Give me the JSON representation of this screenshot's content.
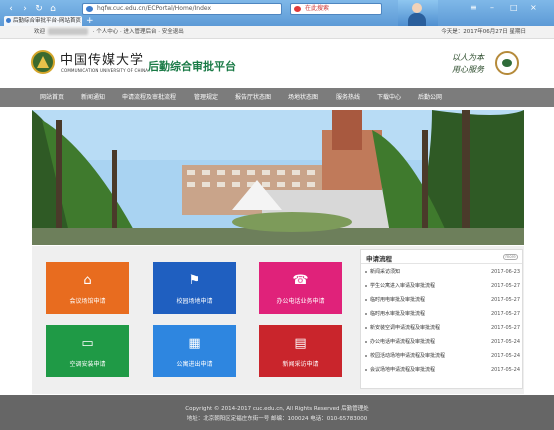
{
  "browser": {
    "back_icon": "back-arrow-icon",
    "forward_icon": "forward-arrow-icon",
    "refresh_icon": "refresh-icon",
    "home_icon": "home-icon",
    "address": "hqfw.cuc.edu.cn/ECPortal/Home/Index",
    "search_placeholder": "在此搜索",
    "tab_title": "后勤综合审批平台-网站首页",
    "tab_close": "×",
    "new_tab": "+"
  },
  "topbar": {
    "welcome": "欢迎",
    "personal_center": "个人中心",
    "admin_backend": "进入管理后台",
    "logout": "安全退出",
    "date_text": "今天是：2017年06月27日 星期日"
  },
  "header": {
    "school_name_cn": "中国传媒大学",
    "school_name_en": "COMMUNICATION UNIVERSITY OF CHINA",
    "system_title": "后勤综合审批平台",
    "motto_line1": "以人为本",
    "motto_line2": "用心服务"
  },
  "nav": {
    "items": [
      {
        "label": "网站首页"
      },
      {
        "label": "新闻通知"
      },
      {
        "label": "申请流程及审批流程"
      },
      {
        "label": "管理规定"
      },
      {
        "label": "报告厅状态图"
      },
      {
        "label": "场地状态图"
      },
      {
        "label": "服务热线"
      },
      {
        "label": "下载中心"
      },
      {
        "label": "后勤公网"
      }
    ]
  },
  "tiles": [
    {
      "label": "会议场馆申请",
      "icon": "building-icon",
      "color": "#e86c1f"
    },
    {
      "label": "校园场地申请",
      "icon": "flag-icon",
      "color": "#1f5fc0"
    },
    {
      "label": "办公电话业务申请",
      "icon": "telephone-icon",
      "color": "#e0227a"
    },
    {
      "label": "空调安装申请",
      "icon": "air-conditioner-icon",
      "color": "#1f9a46"
    },
    {
      "label": "公寓进出申请",
      "icon": "apartment-icon",
      "color": "#2e86e0"
    },
    {
      "label": "新闻采访申请",
      "icon": "newspaper-icon",
      "color": "#c9252c"
    }
  ],
  "notice": {
    "title": "申请流程",
    "more": "more",
    "items": [
      {
        "title": "新闻采访须知",
        "date": "2017-06-23"
      },
      {
        "title": "学生公寓进入审请及审批流程",
        "date": "2017-05-27"
      },
      {
        "title": "临时用电审批及审批流程",
        "date": "2017-05-27"
      },
      {
        "title": "临时用水审批及审批流程",
        "date": "2017-05-27"
      },
      {
        "title": "新安装空调申请流程及审批流程",
        "date": "2017-05-27"
      },
      {
        "title": "办公电话申请流程及审批流程",
        "date": "2017-05-24"
      },
      {
        "title": "校园活动场地申请流程及审批流程",
        "date": "2017-05-24"
      },
      {
        "title": "会议场地申请流程及审批流程",
        "date": "2017-05-24"
      }
    ]
  },
  "footer": {
    "copyright": "Copyright © 2014-2017 cuc.edu.cn, All Rights Reserved 后勤管理处",
    "address": "地址：北京朝阳区定福庄东街一号 邮编：100024 电话：010-65783000"
  }
}
